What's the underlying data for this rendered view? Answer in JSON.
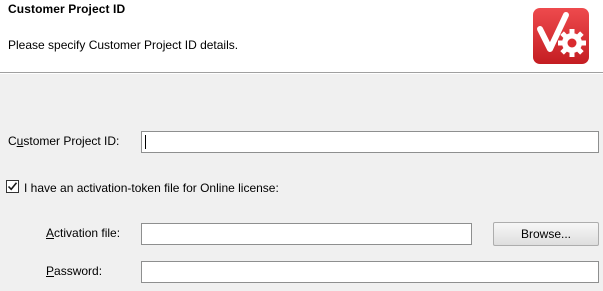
{
  "header": {
    "title": "Customer Project ID",
    "subtitle": "Please specify Customer Project ID details.",
    "logo_icon": "red-checkmark-gear-logo",
    "logo_color": "#d92b2f"
  },
  "form": {
    "project_id": {
      "label_pre": "C",
      "label_ul": "u",
      "label_post": "stomer Project ID:",
      "value": ""
    },
    "activation_checkbox": {
      "checked": true,
      "label": "I have an activation-token file for Online license:"
    },
    "activation_file": {
      "label_ul": "A",
      "label_post": "ctivation file:",
      "value": ""
    },
    "browse_button": {
      "label": "Browse..."
    },
    "password": {
      "label_ul": "P",
      "label_post": "assword:",
      "value": ""
    }
  }
}
